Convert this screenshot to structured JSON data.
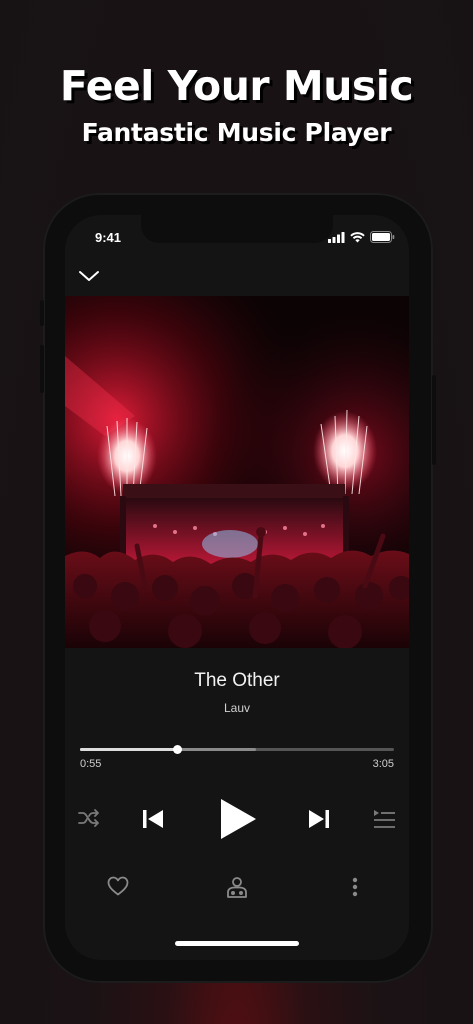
{
  "promo": {
    "headline": "Feel Your Music",
    "subheadline": "Fantastic Music Player"
  },
  "status_bar": {
    "time": "9:41"
  },
  "now_playing": {
    "title": "The Other",
    "artist": "Lauv",
    "elapsed": "0:55",
    "duration": "3:05",
    "progress_fraction": 0.308,
    "buffer_fraction": 0.56
  },
  "icons": {
    "collapse": "chevron-down-icon",
    "shuffle": "shuffle-icon",
    "previous": "skip-previous-icon",
    "play": "play-icon",
    "next": "skip-next-icon",
    "queue": "queue-list-icon",
    "favorite": "heart-icon",
    "share": "people-share-icon",
    "more": "more-vertical-icon"
  },
  "colors": {
    "accent": "#ffffff",
    "screen_bg": "#141414",
    "art_glow": "#e0142a"
  }
}
